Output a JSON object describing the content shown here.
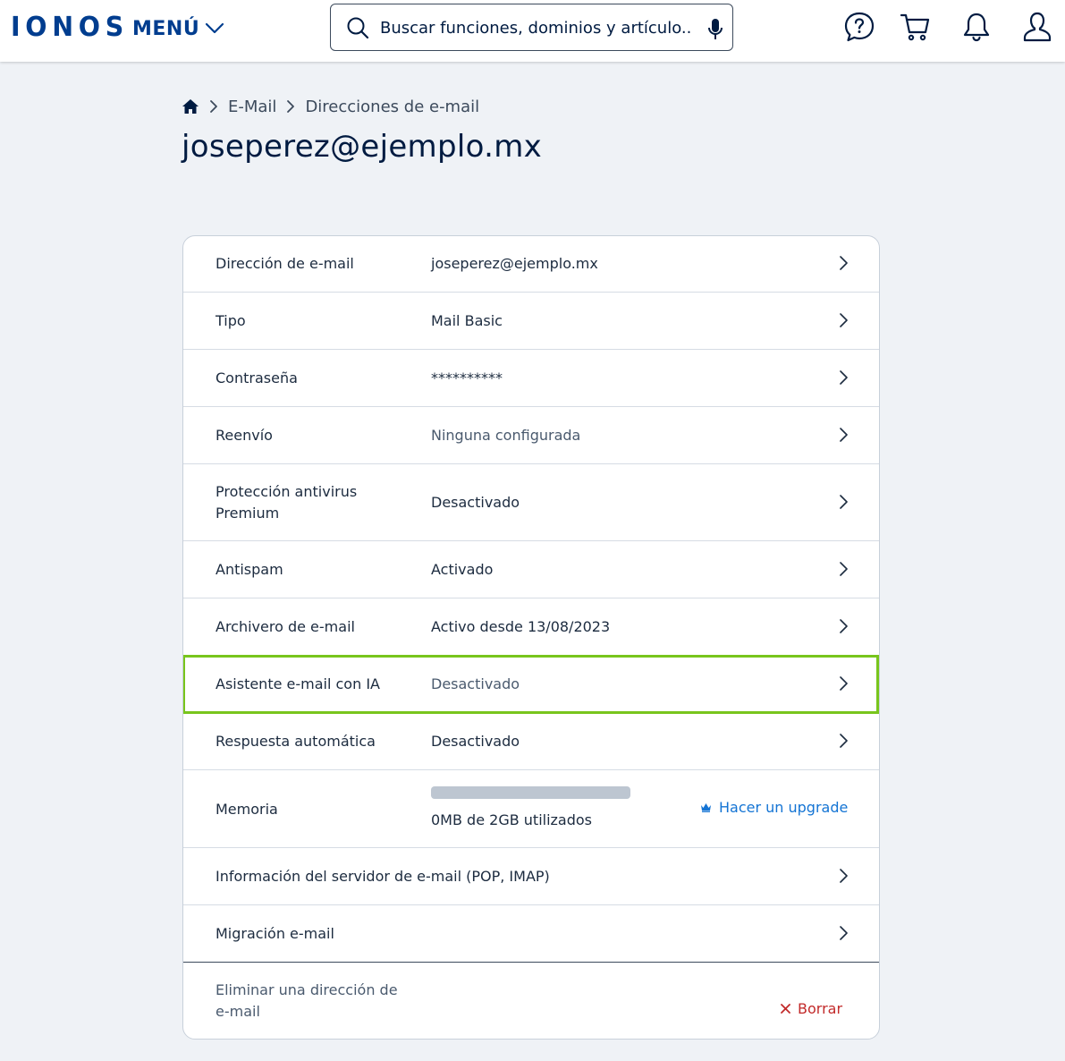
{
  "header": {
    "logo": "IONOS",
    "menu_label": "MENÚ",
    "search_placeholder": "Buscar funciones, dominios y artículo..."
  },
  "breadcrumb": {
    "items": [
      "E-Mail",
      "Direcciones de e-mail"
    ]
  },
  "page_title": "joseperez@ejemplo.mx",
  "rows": [
    {
      "label": "Dirección de e-mail",
      "value": "joseperez@ejemplo.mx"
    },
    {
      "label": "Tipo",
      "value": "Mail Basic"
    },
    {
      "label": "Contraseña",
      "value": "**********"
    },
    {
      "label": "Reenvío",
      "value": "Ninguna configurada"
    },
    {
      "label": "Protección antivirus Premium",
      "value": "Desactivado"
    },
    {
      "label": "Antispam",
      "value": "Activado"
    },
    {
      "label": "Archivero de e-mail",
      "value": "Activo desde 13/08/2023"
    },
    {
      "label": "Asistente e-mail con IA",
      "value": "Desactivado"
    },
    {
      "label": "Respuesta automática",
      "value": "Desactivado"
    },
    {
      "label": "Memoria",
      "value": "0MB de 2GB utilizados",
      "usage_fraction": 0.0,
      "action": "Hacer un upgrade"
    },
    {
      "label": "Información del servidor de e-mail (POP, IMAP)",
      "value": ""
    },
    {
      "label": "Migración e-mail",
      "value": ""
    },
    {
      "label": "Eliminar una dirección de e-mail",
      "action": "Borrar"
    }
  ],
  "colors": {
    "brand": "#003d8f",
    "highlight": "#78c51c",
    "link": "#1474d4",
    "danger": "#c22a2a"
  },
  "icons": {
    "header": [
      "help-icon",
      "cart-icon",
      "bell-icon",
      "user-icon"
    ],
    "row_action": "chevron-right-icon",
    "upgrade": "crown-icon",
    "delete": "close-icon"
  }
}
